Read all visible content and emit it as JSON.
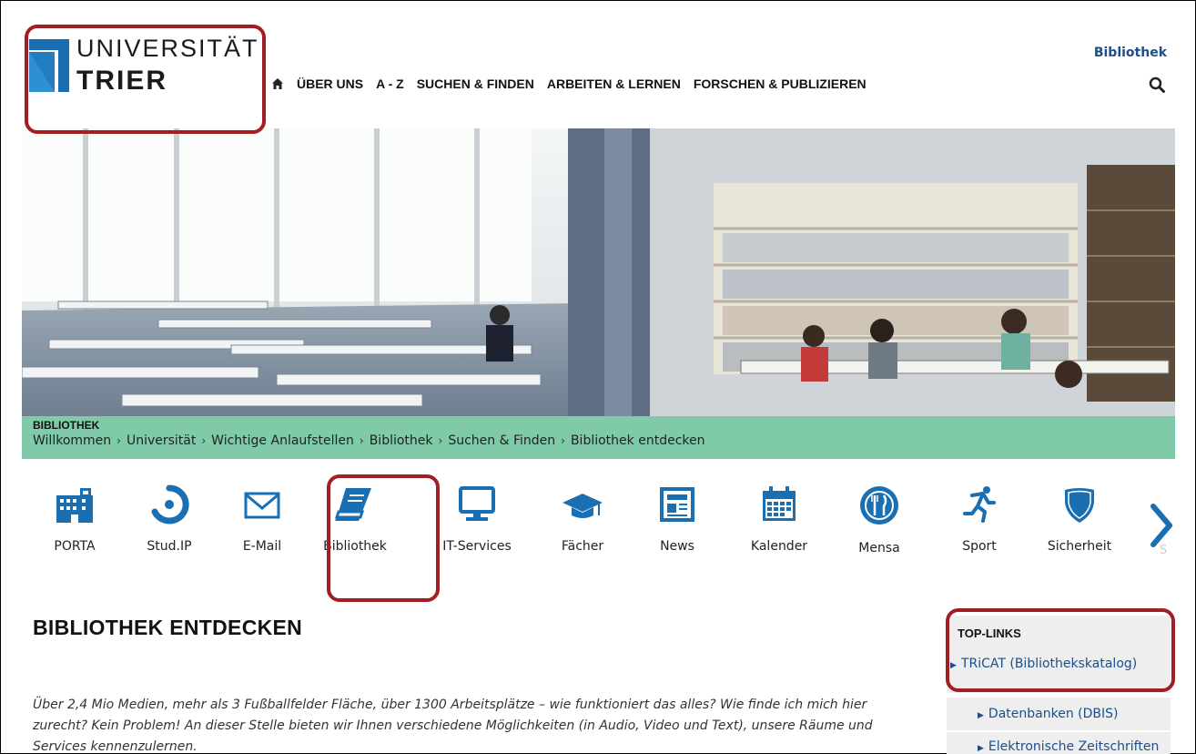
{
  "logo": {
    "line1": "UNIVERSITÄT",
    "line2": "TRIER",
    "brand_color": "#1a6fb3"
  },
  "header": {
    "context_link": "Bibliothek",
    "nav": [
      {
        "label": "ÜBER UNS"
      },
      {
        "label": "A - Z"
      },
      {
        "label": "SUCHEN & FINDEN"
      },
      {
        "label": "ARBEITEN & LERNEN"
      },
      {
        "label": "FORSCHEN & PUBLIZIEREN"
      }
    ],
    "home_icon": "home-icon",
    "search_icon": "search-icon"
  },
  "breadcrumb": {
    "section": "BIBLIOTHEK",
    "items": [
      "Willkommen",
      "Universität",
      "Wichtige Anlaufstellen",
      "Bibliothek",
      "Suchen & Finden",
      "Bibliothek entdecken"
    ],
    "bar_color": "#7fcaa9"
  },
  "quicklinks": {
    "items": [
      {
        "label": "PORTA",
        "icon": "building-icon"
      },
      {
        "label": "Stud.IP",
        "icon": "studip-icon"
      },
      {
        "label": "E-Mail",
        "icon": "envelope-icon"
      },
      {
        "label": "Bibliothek",
        "icon": "book-icon"
      },
      {
        "label": "IT-Services",
        "icon": "monitor-icon"
      },
      {
        "label": "Fächer",
        "icon": "graduation-cap-icon"
      },
      {
        "label": "News",
        "icon": "newspaper-icon"
      },
      {
        "label": "Kalender",
        "icon": "calendar-icon"
      },
      {
        "label": "Mensa",
        "icon": "cutlery-icon"
      },
      {
        "label": "Sport",
        "icon": "running-icon"
      },
      {
        "label": "Sicherheit",
        "icon": "shield-icon"
      }
    ],
    "next_icon": "chevron-right-icon",
    "clipped_label": "S",
    "icon_color": "#1a6fb3"
  },
  "main": {
    "title": "BIBLIOTHEK ENTDECKEN",
    "intro": "Über 2,4 Mio Medien, mehr als 3 Fußballfelder Fläche, über 1300 Arbeitsplätze – wie funktioniert das alles? Wie finde ich mich hier zurecht?  Kein Problem! An dieser Stelle bieten wir Ihnen verschiedene Möglichkeiten (in Audio, Video und Text), unsere Räume und Services kennenzulernen."
  },
  "sidebar": {
    "heading": "TOP-LINKS",
    "links": [
      {
        "label": "TRiCAT (Bibliothekskatalog)"
      },
      {
        "label": "Datenbanken (DBIS)"
      },
      {
        "label": "Elektronische Zeitschriften"
      }
    ]
  },
  "annotation_color": "#a11e22"
}
